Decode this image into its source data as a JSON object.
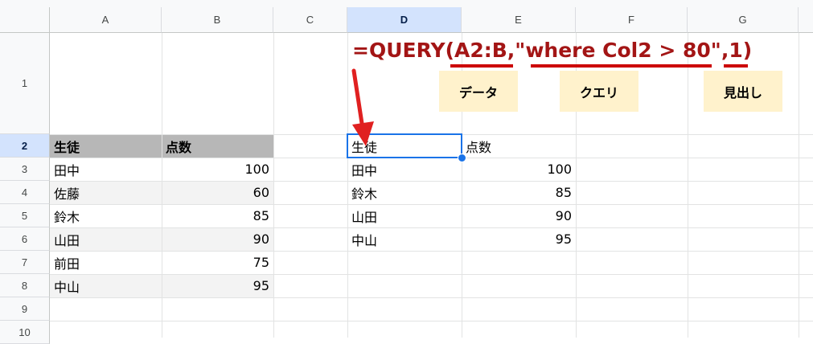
{
  "columns": [
    "A",
    "B",
    "C",
    "D",
    "E",
    "F",
    "G"
  ],
  "selected_column": "D",
  "rows": [
    "1",
    "2",
    "3",
    "4",
    "5",
    "6",
    "7",
    "8",
    "9",
    "10"
  ],
  "selected_row": "2",
  "source_table": {
    "header": [
      "生徒",
      "点数"
    ],
    "records": [
      [
        "田中",
        "100"
      ],
      [
        "佐藤",
        "60"
      ],
      [
        "鈴木",
        "85"
      ],
      [
        "山田",
        "90"
      ],
      [
        "前田",
        "75"
      ],
      [
        "中山",
        "95"
      ]
    ]
  },
  "result_table": {
    "header": [
      "生徒",
      "点数"
    ],
    "records": [
      [
        "田中",
        "100"
      ],
      [
        "鈴木",
        "85"
      ],
      [
        "山田",
        "90"
      ],
      [
        "中山",
        "95"
      ]
    ]
  },
  "formula": {
    "prefix": "=QUERY(",
    "data_arg": "A2:B",
    "sep1": ",",
    "query_arg": "\"where Col2 > 80\"",
    "sep2": ",",
    "headers_arg": "1)"
  },
  "annotations": {
    "data_label": "データ",
    "query_label": "クエリ",
    "headers_label": "見出し"
  },
  "colors": {
    "formula_text": "#a31515",
    "underline": "#cc0000",
    "arrow": "#e02020",
    "tag_bg": "#fff2cc",
    "header_row_bg": "#b7b7b7",
    "band_bg": "#f3f3f3",
    "selection": "#1a73e8"
  }
}
